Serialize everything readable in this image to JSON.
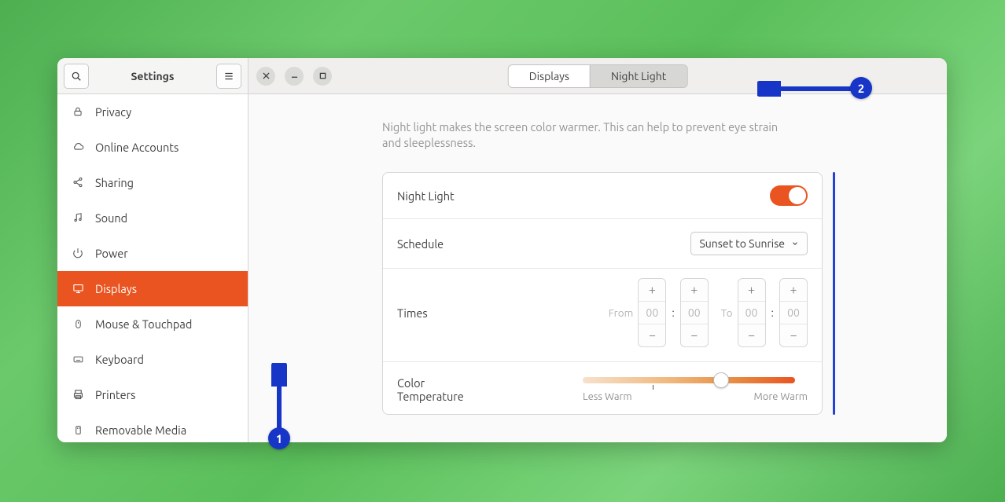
{
  "window": {
    "title": "Settings"
  },
  "tabs": {
    "displays": "Displays",
    "night_light": "Night Light"
  },
  "sidebar": {
    "items": [
      {
        "id": "privacy",
        "label": "Privacy",
        "icon": "lock-icon"
      },
      {
        "id": "online-accounts",
        "label": "Online Accounts",
        "icon": "cloud-icon"
      },
      {
        "id": "sharing",
        "label": "Sharing",
        "icon": "share-icon"
      },
      {
        "id": "sound",
        "label": "Sound",
        "icon": "music-icon"
      },
      {
        "id": "power",
        "label": "Power",
        "icon": "power-icon"
      },
      {
        "id": "displays",
        "label": "Displays",
        "icon": "display-icon"
      },
      {
        "id": "mouse-touchpad",
        "label": "Mouse & Touchpad",
        "icon": "mouse-icon"
      },
      {
        "id": "keyboard",
        "label": "Keyboard",
        "icon": "keyboard-icon"
      },
      {
        "id": "printers",
        "label": "Printers",
        "icon": "printer-icon"
      },
      {
        "id": "removable-media",
        "label": "Removable Media",
        "icon": "media-icon"
      }
    ],
    "selected": "displays"
  },
  "content": {
    "description": "Night light makes the screen color warmer. This can help to prevent eye strain and sleeplessness.",
    "night_light_label": "Night Light",
    "night_light_on": true,
    "schedule_label": "Schedule",
    "schedule_value": "Sunset to Sunrise",
    "times_label": "Times",
    "times_from_label": "From",
    "times_to_label": "To",
    "time_from_h": "00",
    "time_from_m": "00",
    "time_to_h": "00",
    "time_to_m": "00",
    "color_temp_label": "Color Temperature",
    "less_warm": "Less Warm",
    "more_warm": "More Warm",
    "slider_pos_pct": 65
  },
  "annotations": {
    "badge1": "1",
    "badge2": "2"
  },
  "colors": {
    "accent": "#e95420",
    "annotation": "#1735c7"
  }
}
